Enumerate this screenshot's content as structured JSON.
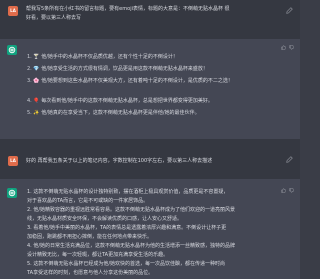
{
  "conversation": {
    "first_exchange": {
      "user": {
        "avatar_initials": "LA",
        "lines": [
          "帮我写5条所有在小红书的留言标题，要有emoji表情，标题的大意是：不倒萌无贴水晶杯 很",
          "好看，要以第三人称去写"
        ]
      },
      "assistant": {
        "items": [
          {
            "num": "1.",
            "text": "🍸 他/她手中的水晶杯不仅品质优越，还有个性十足的不倒设计！"
          },
          {
            "num": "2.",
            "text": "💎 他/她享受生活的方式很有情调，饮品更是用这款不倒萌无贴水晶杯来盛放！"
          },
          {
            "num": "3.",
            "text": "🌸 他/她要想到这些水晶杯不仅美观大方，还有着吨十足的不倒设计，是优质的不二之选！"
          },
          {
            "num": "4.",
            "text": "🎈 每次看到他/她手中的这款不倒萌无贴水晶杯，总是想把世界都变得更加美好。"
          },
          {
            "num": "5.",
            "text": "✨ 他/她真的在享受当下，这款不倒萌无贴水晶杯更是伴他/她的最佳伙伴。"
          }
        ]
      }
    },
    "second_exchange": {
      "user": {
        "avatar_initials": "LA",
        "lines": [
          "好的 再帮我五条关于以上的笔记内容，字数控制在100字左右，要以第三人称去描述"
        ]
      },
      "assistant": {
        "lines": [
          "1. 这款不倒萌无贴水晶杯的设计独特别致，摆在酒柜上极具观赏价值，品质更是不容置疑，",
          "   对于喜欢晶的TA而言，它是不可或缺的一件家居饰品。",
          "2. 他/她精致容器的重视远胜常看容易。这款不倒萌无贴水晶杯成为了他们欢迎的一道亮丽风景",
          "   线，无贴水晶材质安全环保，不会解读优质的口感，让人安心又舒适。",
          "3. 看着他/她手中美丽的水晶杯，TA的表情总是透露着浓厚兴趣和满意。不倒设计让杯子更",
          "   加稳固，跑跳都不用担心摔倒，能在任何地点带来快乐。",
          "4. 他/她的日常生活充满品位，这款不倒萌无贴水晶杯为他的生活增添一丝精致感，独特的品牌",
          "   设计精致无比，每一次轻啜，都让TA更加充满享受生活的乐趣。",
          "5. 这款不倒萌无贴水晶杯已经成为他/她欢快的首选，每一次品饮佳酿，都在传递一种时尚",
          "   TA享受这样的时刻，也愿意与他人分享这份美丽的品位。"
        ]
      }
    }
  }
}
